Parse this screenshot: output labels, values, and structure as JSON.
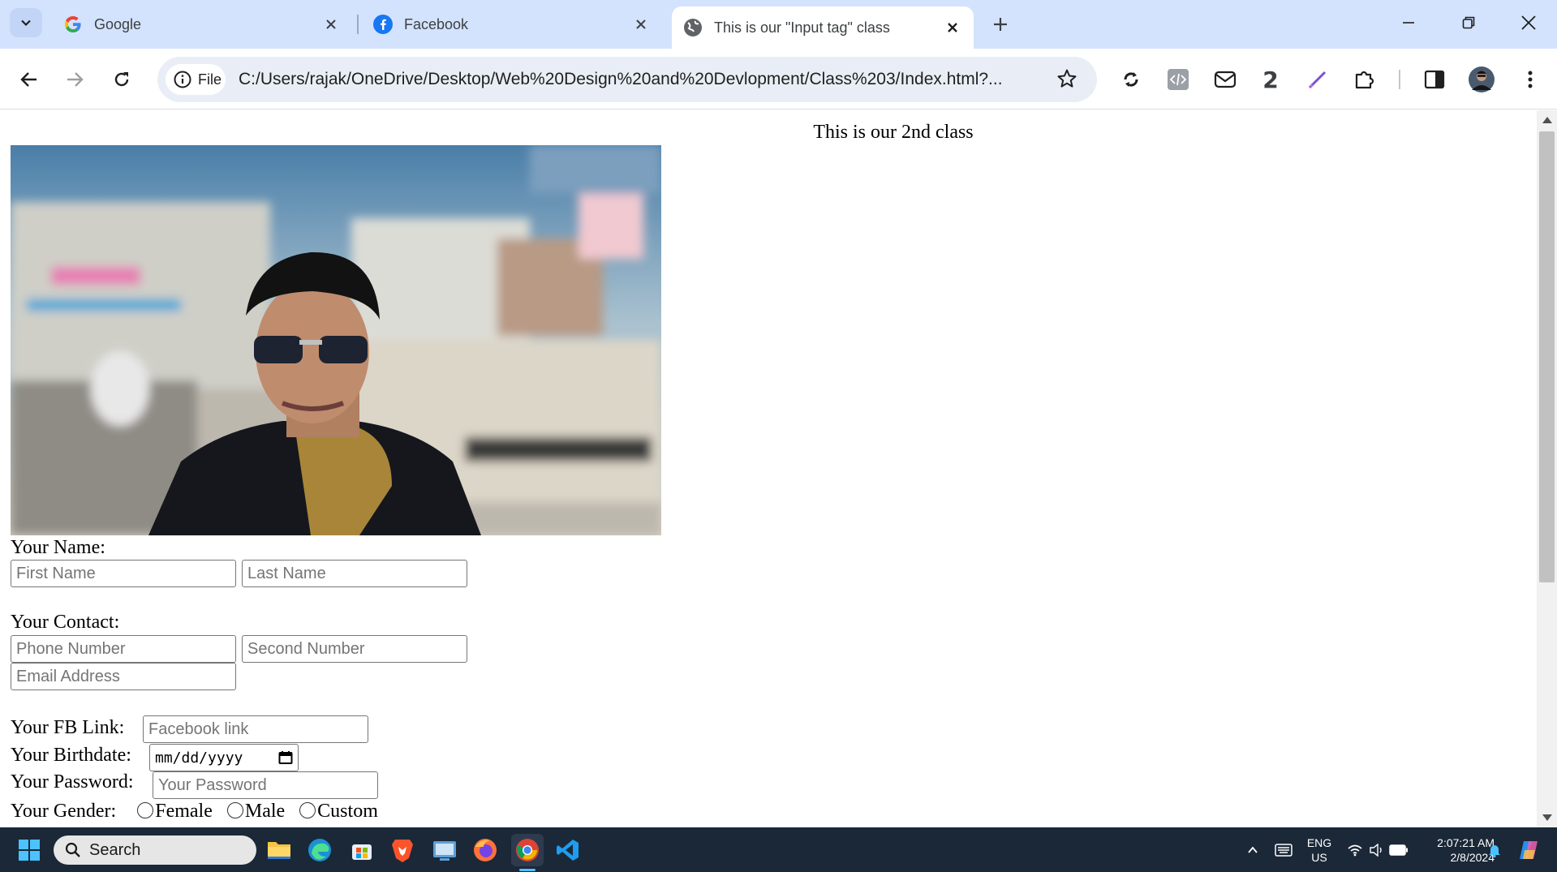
{
  "browser": {
    "tabs": [
      {
        "title": "Google",
        "favicon": "google-icon",
        "active": false
      },
      {
        "title": "Facebook",
        "favicon": "facebook-icon",
        "active": false
      },
      {
        "title": "This is our \"Input tag\" class",
        "favicon": "globe-icon",
        "active": true
      }
    ],
    "address": {
      "chip_label": "File",
      "url": "C:/Users/rajak/OneDrive/Desktop/Web%20Design%20and%20Devlopment/Class%203/Index.html?..."
    },
    "extension_badge": "2"
  },
  "page": {
    "heading": "This is our 2nd class",
    "form": {
      "name_label": "Your Name:",
      "first_name_placeholder": "First Name",
      "last_name_placeholder": "Last Name",
      "contact_label": "Your Contact:",
      "phone_placeholder": "Phone Number",
      "second_number_placeholder": "Second Number",
      "email_placeholder": "Email Address",
      "fb_label": "Your FB Link:",
      "fb_placeholder": "Facebook link",
      "birthdate_label": "Your Birthdate:",
      "birthdate_value": "mm/dd/yyyy",
      "password_label": "Your Password:",
      "password_placeholder": "Your Password",
      "gender_label": "Your Gender:",
      "gender_options": [
        "Female",
        "Male",
        "Custom"
      ]
    }
  },
  "taskbar": {
    "search_label": "Search",
    "language": "ENG",
    "region": "US",
    "time": "2:07:21 AM",
    "date": "2/8/2024"
  },
  "colors": {
    "tabstrip": "#d3e3fd",
    "omnibox": "#e9eef6",
    "taskbar": "#1a2838"
  }
}
